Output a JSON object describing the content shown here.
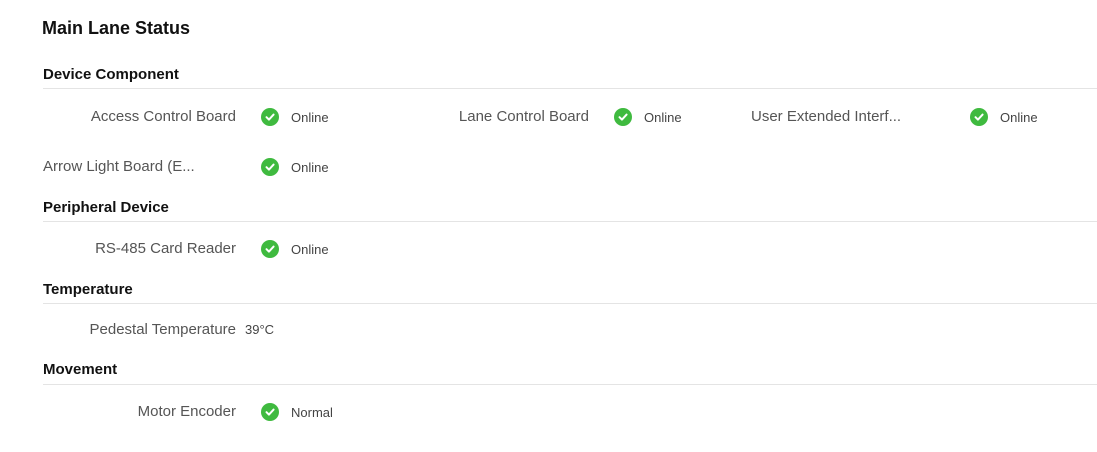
{
  "title": "Main Lane Status",
  "sections": {
    "device_component": {
      "title": "Device Component",
      "items": [
        {
          "label": "Access Control Board",
          "status": "Online"
        },
        {
          "label": "Lane Control Board",
          "status": "Online"
        },
        {
          "label": "User Extended Interf...",
          "status": "Online"
        },
        {
          "label": "Arrow Light Board (E...",
          "status": "Online"
        }
      ]
    },
    "peripheral_device": {
      "title": "Peripheral Device",
      "items": [
        {
          "label": "RS-485 Card Reader",
          "status": "Online"
        }
      ]
    },
    "temperature": {
      "title": "Temperature",
      "items": [
        {
          "label": "Pedestal Temperature",
          "value": "39°C"
        }
      ]
    },
    "movement": {
      "title": "Movement",
      "items": [
        {
          "label": "Motor Encoder",
          "status": "Normal"
        }
      ]
    }
  },
  "colors": {
    "status_ok": "#3fba3f"
  },
  "icons": {
    "status_ok": "check-circle-icon"
  }
}
